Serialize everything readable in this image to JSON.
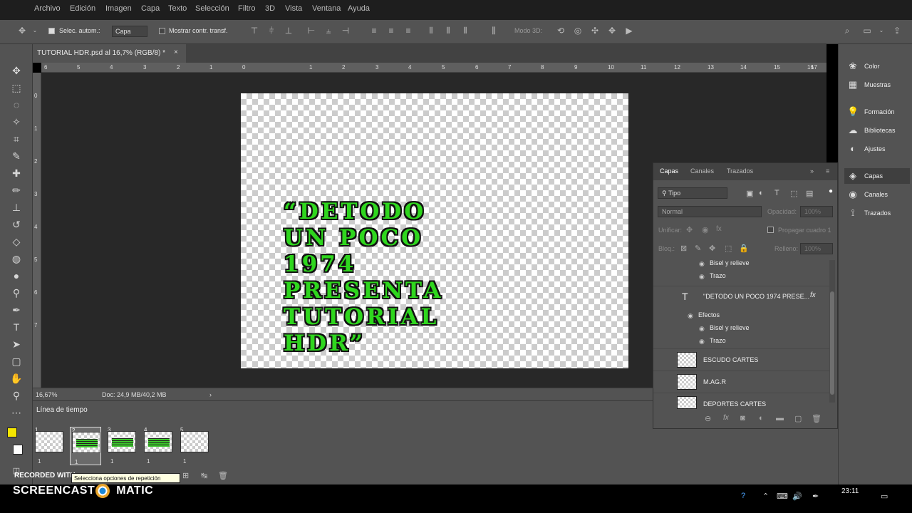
{
  "menubar": {
    "items": [
      "Archivo",
      "Edición",
      "Imagen",
      "Capa",
      "Texto",
      "Selección",
      "Filtro",
      "3D",
      "Vista",
      "Ventana",
      "Ayuda"
    ]
  },
  "options": {
    "auto_select_label": "Selec. autom.:",
    "auto_select_checked": true,
    "target_value": "Capa",
    "show_transform_label": "Mostrar contr. transf.",
    "mode3d_label": "Modo 3D:"
  },
  "document": {
    "tab_title": "TUTORIAL HDR.psd al 16,7% (RGB/8) *",
    "tab_close": "×",
    "text_lines": [
      "“DETODO",
      "UN POCO",
      "1974",
      "PRESENTA",
      "TUTORIAL",
      "HDR”"
    ]
  },
  "ruler": {
    "ticks": [
      "6",
      "5",
      "4",
      "3",
      "2",
      "1",
      "0",
      "1",
      "2",
      "3",
      "4",
      "5",
      "6",
      "7",
      "8",
      "9",
      "10",
      "11",
      "12",
      "13",
      "14",
      "15",
      "16",
      "17"
    ],
    "vticks": [
      "0",
      "1",
      "2",
      "3",
      "4",
      "5",
      "6",
      "7"
    ]
  },
  "status": {
    "zoom": "16,67%",
    "doc_size": "Doc: 24,9 MB/40,2 MB",
    "arrow": "›"
  },
  "timeline": {
    "title": "Línea de tiempo",
    "frames": [
      {
        "num": "1",
        "meta": "1",
        "selected": false,
        "has_text": false
      },
      {
        "num": "2",
        "meta": "1",
        "selected": true,
        "has_text": true
      },
      {
        "num": "3",
        "meta": "1",
        "selected": false,
        "has_text": true
      },
      {
        "num": "4",
        "meta": "1",
        "selected": false,
        "has_text": true
      },
      {
        "num": "5",
        "meta": "1",
        "selected": false,
        "has_text": false
      }
    ]
  },
  "tooltip": "Selecciona opciones de repetición",
  "watermark": {
    "line1": "RECORDED WITH",
    "line2a": "SCREENCAST",
    "line2b": "MATIC"
  },
  "right_strip": {
    "items": [
      {
        "label": "Color",
        "icon": "color-icon",
        "glyph": "❀"
      },
      {
        "label": "Muestras",
        "icon": "swatches-icon",
        "glyph": "▦"
      },
      {
        "label": "Formación",
        "icon": "learn-icon",
        "glyph": "💡"
      },
      {
        "label": "Bibliotecas",
        "icon": "libraries-icon",
        "glyph": "☁"
      },
      {
        "label": "Ajustes",
        "icon": "adjustments-icon",
        "glyph": "◐"
      },
      {
        "label": "Capas",
        "icon": "layers-icon",
        "glyph": "◈"
      },
      {
        "label": "Canales",
        "icon": "channels-icon",
        "glyph": "◉"
      },
      {
        "label": "Trazados",
        "icon": "paths-icon",
        "glyph": "⟟"
      }
    ]
  },
  "layers_panel": {
    "tabs": [
      "Capas",
      "Canales",
      "Trazados"
    ],
    "filter_label": "Tipo",
    "blend_mode": "Normal",
    "opacity_label": "Opacidad:",
    "opacity_value": "100%",
    "unify_label": "Unificar:",
    "propagate_label": "Propagar cuadro 1",
    "lock_label": "Bloq.:",
    "fill_label": "Relleno:",
    "fill_value": "100%",
    "rows": {
      "bevel1": "Bisel y relieve",
      "stroke1": "Trazo",
      "text_layer": "\"DETODO UN POCO 1974 PRESE...",
      "fx": "fx",
      "effects": "Efectos",
      "bevel2": "Bisel y relieve",
      "stroke2": "Trazo",
      "layer1": "ESCUDO CARTES",
      "layer2": "M.AG.R",
      "layer3": "DEPORTES CARTES"
    }
  },
  "taskbar": {
    "clock": "23:11"
  },
  "colors": {
    "foreground": "#f5e600",
    "background": "#ffffff",
    "text_green": "#2fd61e"
  }
}
